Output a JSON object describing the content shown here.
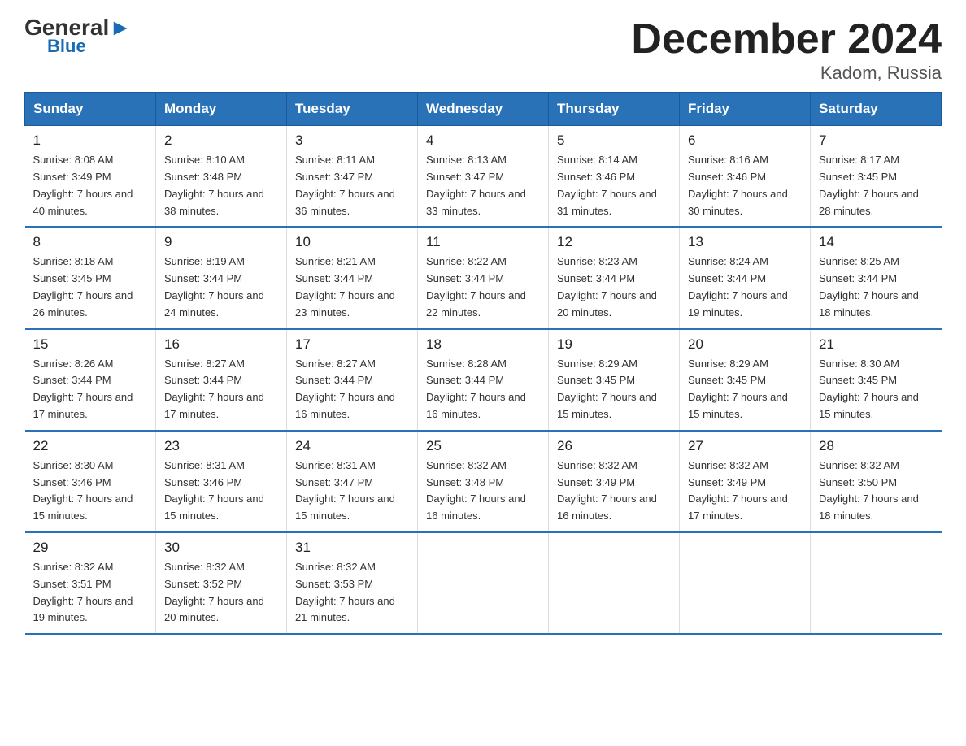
{
  "header": {
    "logo_general": "General",
    "logo_blue": "Blue",
    "month_title": "December 2024",
    "location": "Kadom, Russia"
  },
  "days_of_week": [
    "Sunday",
    "Monday",
    "Tuesday",
    "Wednesday",
    "Thursday",
    "Friday",
    "Saturday"
  ],
  "weeks": [
    [
      {
        "num": "1",
        "sunrise": "8:08 AM",
        "sunset": "3:49 PM",
        "daylight": "7 hours and 40 minutes."
      },
      {
        "num": "2",
        "sunrise": "8:10 AM",
        "sunset": "3:48 PM",
        "daylight": "7 hours and 38 minutes."
      },
      {
        "num": "3",
        "sunrise": "8:11 AM",
        "sunset": "3:47 PM",
        "daylight": "7 hours and 36 minutes."
      },
      {
        "num": "4",
        "sunrise": "8:13 AM",
        "sunset": "3:47 PM",
        "daylight": "7 hours and 33 minutes."
      },
      {
        "num": "5",
        "sunrise": "8:14 AM",
        "sunset": "3:46 PM",
        "daylight": "7 hours and 31 minutes."
      },
      {
        "num": "6",
        "sunrise": "8:16 AM",
        "sunset": "3:46 PM",
        "daylight": "7 hours and 30 minutes."
      },
      {
        "num": "7",
        "sunrise": "8:17 AM",
        "sunset": "3:45 PM",
        "daylight": "7 hours and 28 minutes."
      }
    ],
    [
      {
        "num": "8",
        "sunrise": "8:18 AM",
        "sunset": "3:45 PM",
        "daylight": "7 hours and 26 minutes."
      },
      {
        "num": "9",
        "sunrise": "8:19 AM",
        "sunset": "3:44 PM",
        "daylight": "7 hours and 24 minutes."
      },
      {
        "num": "10",
        "sunrise": "8:21 AM",
        "sunset": "3:44 PM",
        "daylight": "7 hours and 23 minutes."
      },
      {
        "num": "11",
        "sunrise": "8:22 AM",
        "sunset": "3:44 PM",
        "daylight": "7 hours and 22 minutes."
      },
      {
        "num": "12",
        "sunrise": "8:23 AM",
        "sunset": "3:44 PM",
        "daylight": "7 hours and 20 minutes."
      },
      {
        "num": "13",
        "sunrise": "8:24 AM",
        "sunset": "3:44 PM",
        "daylight": "7 hours and 19 minutes."
      },
      {
        "num": "14",
        "sunrise": "8:25 AM",
        "sunset": "3:44 PM",
        "daylight": "7 hours and 18 minutes."
      }
    ],
    [
      {
        "num": "15",
        "sunrise": "8:26 AM",
        "sunset": "3:44 PM",
        "daylight": "7 hours and 17 minutes."
      },
      {
        "num": "16",
        "sunrise": "8:27 AM",
        "sunset": "3:44 PM",
        "daylight": "7 hours and 17 minutes."
      },
      {
        "num": "17",
        "sunrise": "8:27 AM",
        "sunset": "3:44 PM",
        "daylight": "7 hours and 16 minutes."
      },
      {
        "num": "18",
        "sunrise": "8:28 AM",
        "sunset": "3:44 PM",
        "daylight": "7 hours and 16 minutes."
      },
      {
        "num": "19",
        "sunrise": "8:29 AM",
        "sunset": "3:45 PM",
        "daylight": "7 hours and 15 minutes."
      },
      {
        "num": "20",
        "sunrise": "8:29 AM",
        "sunset": "3:45 PM",
        "daylight": "7 hours and 15 minutes."
      },
      {
        "num": "21",
        "sunrise": "8:30 AM",
        "sunset": "3:45 PM",
        "daylight": "7 hours and 15 minutes."
      }
    ],
    [
      {
        "num": "22",
        "sunrise": "8:30 AM",
        "sunset": "3:46 PM",
        "daylight": "7 hours and 15 minutes."
      },
      {
        "num": "23",
        "sunrise": "8:31 AM",
        "sunset": "3:46 PM",
        "daylight": "7 hours and 15 minutes."
      },
      {
        "num": "24",
        "sunrise": "8:31 AM",
        "sunset": "3:47 PM",
        "daylight": "7 hours and 15 minutes."
      },
      {
        "num": "25",
        "sunrise": "8:32 AM",
        "sunset": "3:48 PM",
        "daylight": "7 hours and 16 minutes."
      },
      {
        "num": "26",
        "sunrise": "8:32 AM",
        "sunset": "3:49 PM",
        "daylight": "7 hours and 16 minutes."
      },
      {
        "num": "27",
        "sunrise": "8:32 AM",
        "sunset": "3:49 PM",
        "daylight": "7 hours and 17 minutes."
      },
      {
        "num": "28",
        "sunrise": "8:32 AM",
        "sunset": "3:50 PM",
        "daylight": "7 hours and 18 minutes."
      }
    ],
    [
      {
        "num": "29",
        "sunrise": "8:32 AM",
        "sunset": "3:51 PM",
        "daylight": "7 hours and 19 minutes."
      },
      {
        "num": "30",
        "sunrise": "8:32 AM",
        "sunset": "3:52 PM",
        "daylight": "7 hours and 20 minutes."
      },
      {
        "num": "31",
        "sunrise": "8:32 AM",
        "sunset": "3:53 PM",
        "daylight": "7 hours and 21 minutes."
      },
      null,
      null,
      null,
      null
    ]
  ],
  "labels": {
    "sunrise": "Sunrise:",
    "sunset": "Sunset:",
    "daylight": "Daylight:"
  }
}
